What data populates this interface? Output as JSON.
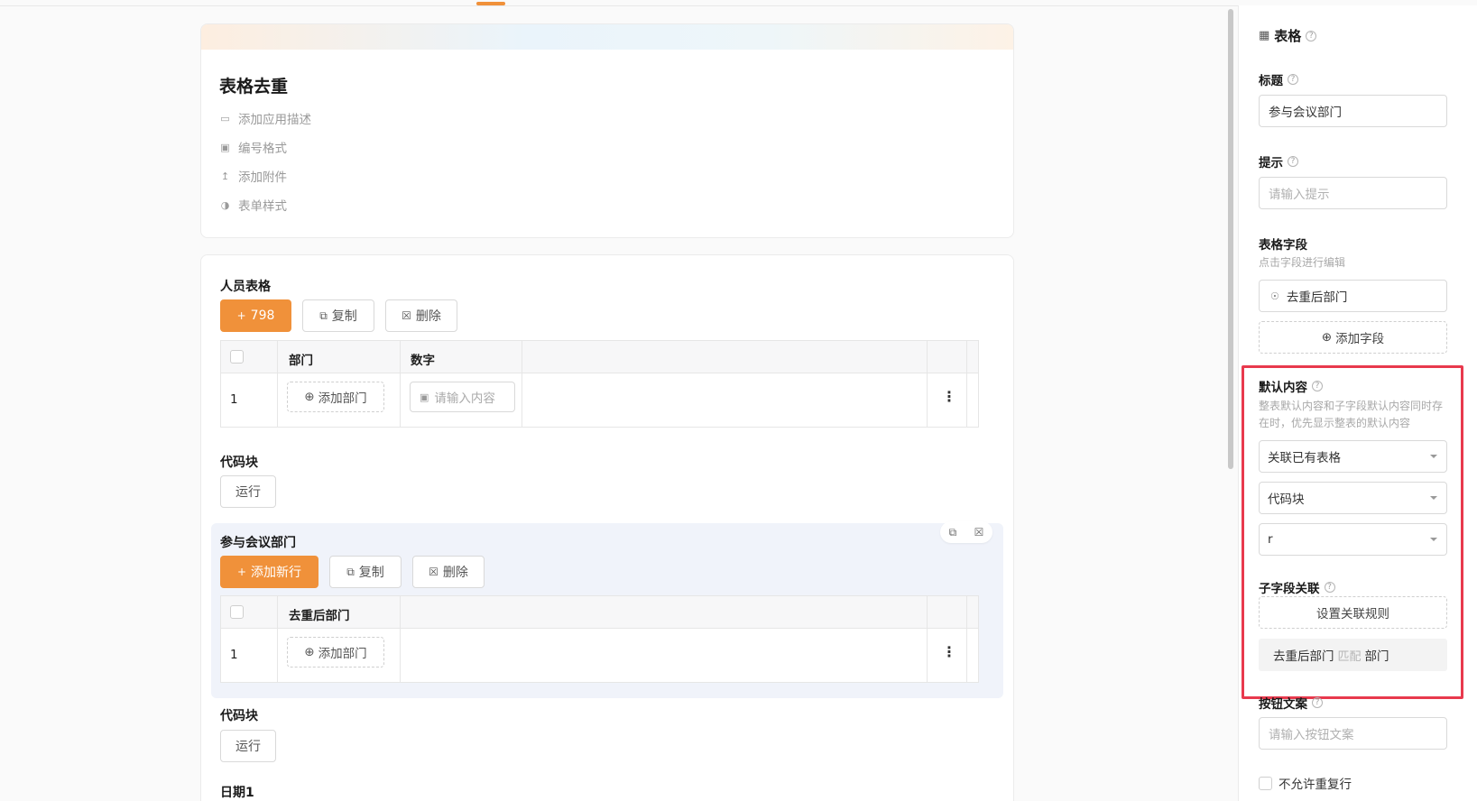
{
  "form": {
    "title": "表格去重",
    "meta": [
      {
        "icon": "comment-icon",
        "label": "添加应用描述"
      },
      {
        "icon": "number-format-icon",
        "label": "编号格式"
      },
      {
        "icon": "upload-icon",
        "label": "添加附件"
      },
      {
        "icon": "palette-icon",
        "label": "表单样式"
      }
    ]
  },
  "table1": {
    "title": "人员表格",
    "add_label": "798",
    "copy_label": "复制",
    "delete_label": "删除",
    "columns": [
      "部门",
      "数字"
    ],
    "row_index": "1",
    "add_dept_label": "添加部门",
    "number_placeholder": "请输入内容"
  },
  "code1": {
    "title": "代码块",
    "run_label": "运行"
  },
  "table2": {
    "title": "参与会议部门",
    "add_label": "添加新行",
    "copy_label": "复制",
    "delete_label": "删除",
    "columns": [
      "去重后部门"
    ],
    "row_index": "1",
    "add_dept_label": "添加部门"
  },
  "code2": {
    "title": "代码块",
    "run_label": "运行"
  },
  "next_section_title": "日期1",
  "side": {
    "header": "表格",
    "title_label": "标题",
    "title_value": "参与会议部门",
    "hint_label": "提示",
    "hint_placeholder": "请输入提示",
    "fields_label": "表格字段",
    "fields_hint": "点击字段进行编辑",
    "field_item": "去重后部门",
    "add_field_label": "添加字段",
    "default_label": "默认内容",
    "default_hint": "整表默认内容和子字段默认内容同时存在时，优先显示整表的默认内容",
    "select1": "关联已有表格",
    "select2": "代码块",
    "select3": "r",
    "sub_link_label": "子字段关联",
    "set_rule_label": "设置关联规则",
    "rule_left": "去重后部门",
    "rule_match": "匹配",
    "rule_right": "部门",
    "button_text_label": "按钮文案",
    "button_text_placeholder": "请输入按钮文案",
    "no_dup_label": "不允许重复行"
  },
  "colors": {
    "accent": "#f0913a",
    "highlight": "#e8394d",
    "subpanel": "#f0f3fa"
  }
}
